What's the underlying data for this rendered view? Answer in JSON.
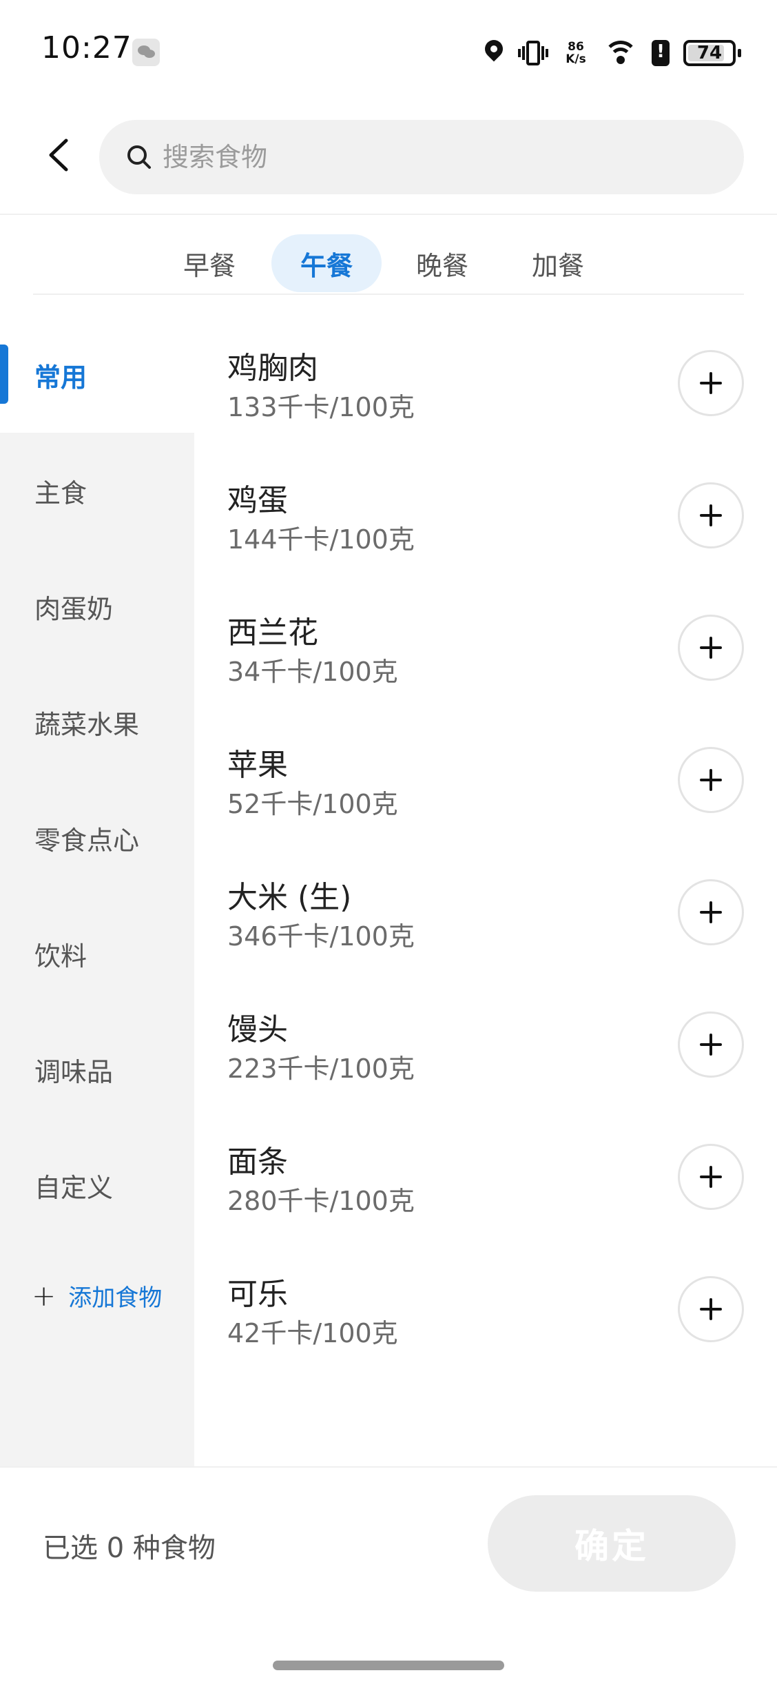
{
  "status_bar": {
    "time": "10:27",
    "speed_top": "86",
    "speed_bottom": "K/s",
    "battery": "74"
  },
  "header": {
    "search_placeholder": "搜索食物"
  },
  "meal_tabs": [
    {
      "label": "早餐",
      "active": false
    },
    {
      "label": "午餐",
      "active": true
    },
    {
      "label": "晚餐",
      "active": false
    },
    {
      "label": "加餐",
      "active": false
    }
  ],
  "categories": [
    {
      "label": "常用",
      "active": true
    },
    {
      "label": "主食",
      "active": false
    },
    {
      "label": "肉蛋奶",
      "active": false
    },
    {
      "label": "蔬菜水果",
      "active": false
    },
    {
      "label": "零食点心",
      "active": false
    },
    {
      "label": "饮料",
      "active": false
    },
    {
      "label": "调味品",
      "active": false
    },
    {
      "label": "自定义",
      "active": false
    }
  ],
  "add_food": {
    "plus": "+",
    "label": "添加食物"
  },
  "foods": [
    {
      "name": "鸡胸肉",
      "calories": "133千卡/100克"
    },
    {
      "name": "鸡蛋",
      "calories": "144千卡/100克"
    },
    {
      "name": "西兰花",
      "calories": "34千卡/100克"
    },
    {
      "name": "苹果",
      "calories": "52千卡/100克"
    },
    {
      "name": "大米 (生)",
      "calories": "346千卡/100克"
    },
    {
      "name": "馒头",
      "calories": "223千卡/100克"
    },
    {
      "name": "面条",
      "calories": "280千卡/100克"
    },
    {
      "name": "可乐",
      "calories": "42千卡/100克"
    }
  ],
  "bottom_bar": {
    "selected_text": "已选 0 种食物",
    "confirm_label": "确定"
  },
  "colors": {
    "accent": "#1677d6",
    "tab_active_bg": "#e5f1fc",
    "sidebar_bg": "#f3f3f3",
    "confirm_disabled_bg": "#ececec"
  }
}
